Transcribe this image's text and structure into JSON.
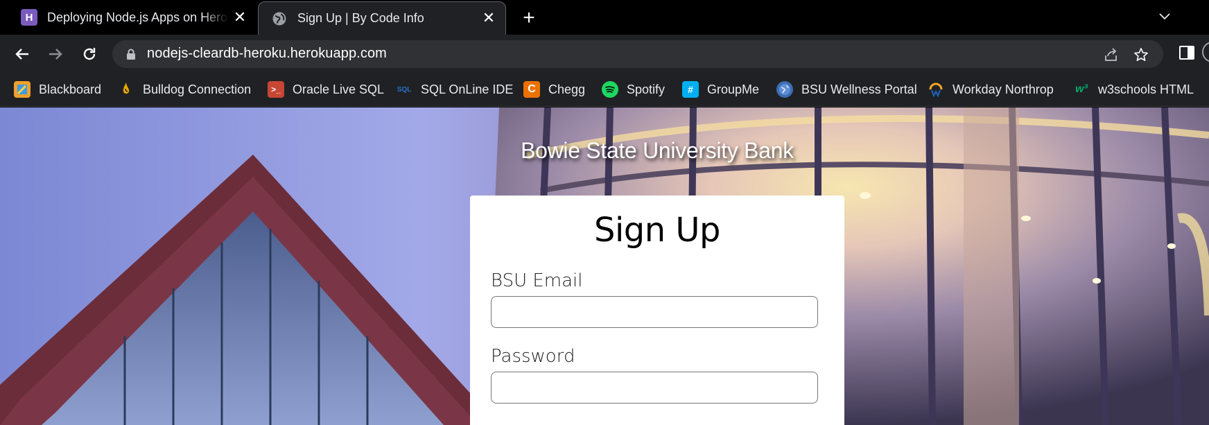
{
  "browser": {
    "tabs": [
      {
        "title": "Deploying Node.js Apps on Heroku",
        "favicon": "heroku-icon",
        "active": false
      },
      {
        "title": "Sign Up | By Code Info",
        "favicon": "globe-icon",
        "active": true
      }
    ],
    "url": "nodejs-cleardb-heroku.herokuapp.com",
    "bookmarks": [
      {
        "label": "Blackboard",
        "icon": "blackboard-icon",
        "color": "#f0a02c"
      },
      {
        "label": "Bulldog Connection",
        "icon": "bulldog-icon",
        "color": "#e8a800"
      },
      {
        "label": "Oracle Live SQL",
        "icon": "oracle-icon",
        "color": "#c74634"
      },
      {
        "label": "SQL OnLine IDE",
        "icon": "sql-icon",
        "color": "#1e5fb3"
      },
      {
        "label": "Chegg",
        "icon": "chegg-icon",
        "color": "#eb7100"
      },
      {
        "label": "Spotify",
        "icon": "spotify-icon",
        "color": "#1ed760"
      },
      {
        "label": "GroupMe",
        "icon": "groupme-icon",
        "color": "#00aff0"
      },
      {
        "label": "BSU Wellness Portal",
        "icon": "globe-icon",
        "color": "#3b6db3"
      },
      {
        "label": "Workday Northrop",
        "icon": "workday-icon",
        "color": "#f5a623"
      },
      {
        "label": "w3schools HTML",
        "icon": "w3schools-icon",
        "color": "#04aa6d"
      }
    ]
  },
  "page": {
    "site_title": "Bowie State University Bank",
    "form": {
      "heading": "Sign Up",
      "email_label": "BSU Email",
      "email_value": "",
      "password_label": "Password",
      "password_value": ""
    }
  }
}
